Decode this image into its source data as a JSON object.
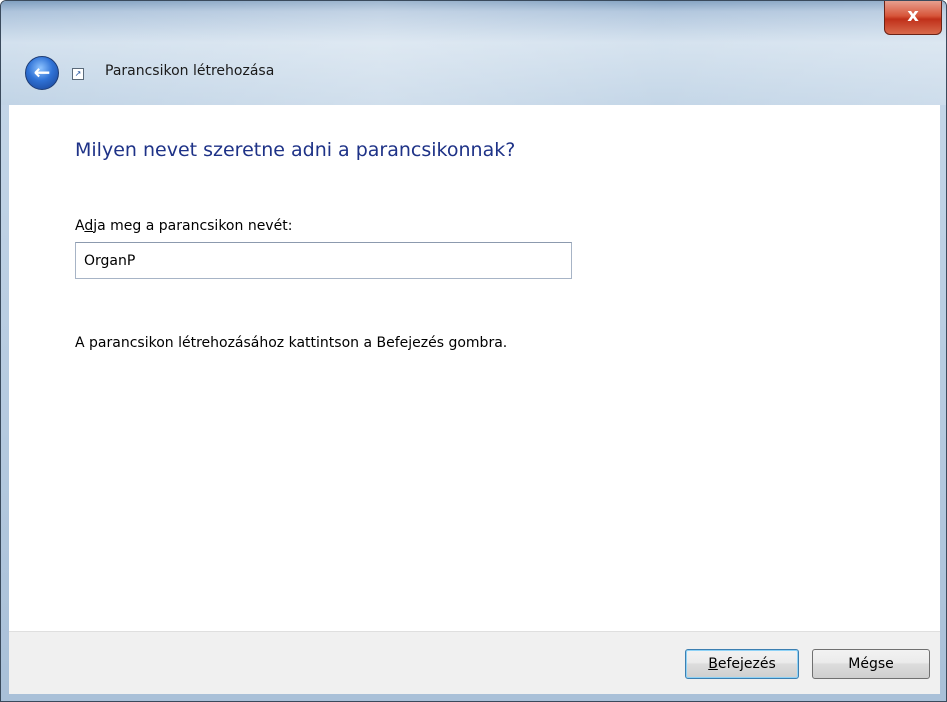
{
  "window": {
    "close_label": "x",
    "title": "Parancsikon létrehozása"
  },
  "main": {
    "heading": "Milyen nevet szeretne adni a parancsikonnak?",
    "field_label_prefix": "A",
    "field_label_access": "d",
    "field_label_rest": "ja meg a parancsikon nevét:",
    "name_value": "OrganP",
    "instruction": "A parancsikon létrehozásához kattintson a Befejezés gombra."
  },
  "footer": {
    "finish_access": "B",
    "finish_rest": "efejezés",
    "cancel_label": "Mégse"
  },
  "colors": {
    "heading": "#1e3287",
    "close": "#c0301a",
    "accent": "#3c7fb1"
  },
  "icons": {
    "back": "back-arrow-icon",
    "close": "close-icon",
    "app": "shortcut-icon"
  }
}
